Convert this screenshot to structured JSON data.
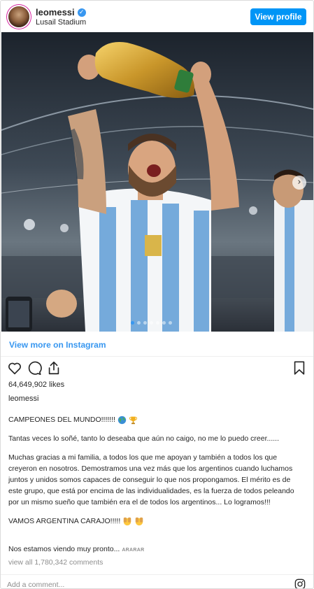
{
  "post": {
    "username": "leomessi",
    "location": "Lusail Stadium",
    "view_profile_label": "View profile",
    "view_more_label": "View more on Instagram",
    "likes": "64,649,902 likes",
    "owner": "leomessi",
    "caption": {
      "line1": "CAMPEONES DEL MUNDO!!!!!!!",
      "line2": "Tantas veces lo soñé, tanto lo deseaba que aún no caigo, no me lo puedo creer......",
      "line3": "Muchas gracias a mi familia, a todos los que me apoyan y también a todos los que creyeron en nosotros. Demostramos una vez más que los argentinos cuando luchamos juntos y unidos somos capaces de conseguir lo que nos propongamos. El mérito es de este grupo, que está por encima de las individualidades, es la fuerza de todos peleando por un mismo sueño que también era el de todos los argentinos... Lo logramos!!!",
      "line4": "VAMOS ARGENTINA CARAJO!!!!!",
      "line5": "Nos estamos viendo muy pronto..."
    },
    "more_word": "ARARAR",
    "comments_label": "view all 1,780,342 comments",
    "add_comment_placeholder": "Add a comment...",
    "carousel": {
      "count": 7,
      "active_index": 0
    }
  },
  "icons": [
    "verified-badge-icon",
    "heart-icon",
    "comment-icon",
    "share-icon",
    "bookmark-icon",
    "globe-emoji-icon",
    "trophy-emoji-icon",
    "covering-face-emoji-icon",
    "instagram-icon",
    "chevron-right-icon"
  ],
  "colors": {
    "accent": "#0095f6",
    "link": "#3897f0",
    "text": "#262626",
    "muted": "#8e8e8e",
    "border": "#dbdbdb"
  }
}
